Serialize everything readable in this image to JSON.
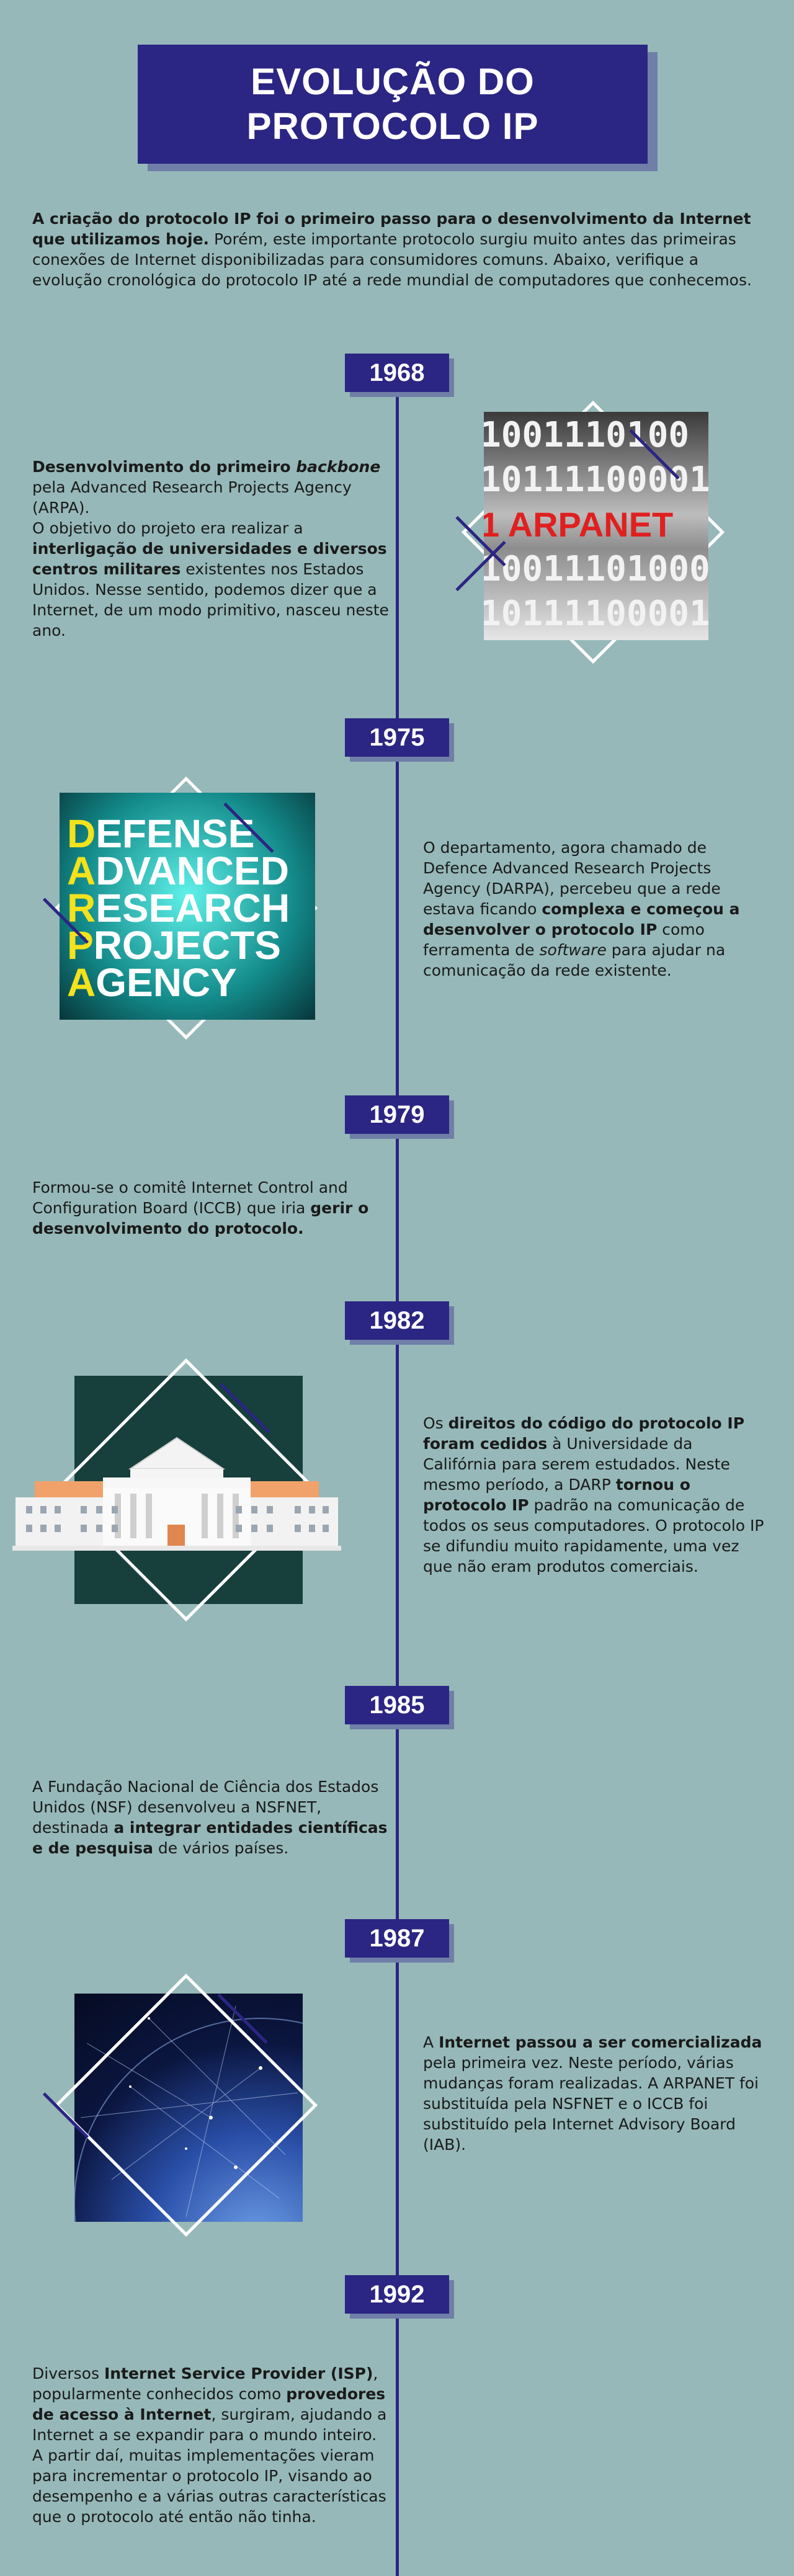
{
  "title": {
    "line1": "EVOLUÇÃO DO",
    "line2": "PROTOCOLO IP"
  },
  "intro": {
    "bold": "A criação do protocolo IP foi o primeiro passo para o desenvolvimento da Internet que utilizamos hoje.",
    "rest": " Porém, este importante protocolo surgiu muito antes das primeiras conexões de Internet disponibilizadas para consumidores comuns. Abaixo, verifique a evolução cronológica do protocolo IP até a rede mundial de computadores que conhecemos."
  },
  "events": [
    {
      "year": "1968",
      "p1_b": "Desenvolvimento do primeiro ",
      "p1_i": "backbone",
      "p1_r": " pela Advanced Research Projects Agency (ARPA).",
      "p2_a": "O objetivo do projeto era realizar a ",
      "p2_b": "interligação de universidades e diversos centros militares",
      "p2_c": " existentes nos Estados Unidos. Nesse sentido, podemos dizer que a Internet, de um modo primitivo, nasceu neste ano.",
      "image_lines": [
        "1001110100",
        "10111100001",
        "1 ARPANET",
        "10011101000",
        "10111100001"
      ],
      "image_alt": "arpanet-image"
    },
    {
      "year": "1975",
      "a": "O departamento, agora chamado de Defence Advanced Research Projects Agency (DARPA), percebeu que a rede estava ficando ",
      "b": "complexa e começou a desenvolver o protocolo IP",
      "c": " como ferramenta de ",
      "i": "software",
      "d": " para ajudar na comunicação da rede existente.",
      "darpa_letters": [
        "D",
        "A",
        "R",
        "P",
        "A"
      ],
      "darpa_words": [
        "EFENSE",
        "DVANCED",
        "ESEARCH",
        "ROJECTS",
        "GENCY"
      ]
    },
    {
      "year": "1979",
      "a": "Formou-se o comitê Internet Control and Configuration Board (ICCB) que iria ",
      "b": "gerir o desenvolvimento do protocolo."
    },
    {
      "year": "1982",
      "a": "Os ",
      "b": "direitos do código do protocolo IP foram cedidos",
      "c": " à Universidade da Califórnia para serem estudados. Neste mesmo período, a DARP ",
      "d": "tornou o protocolo IP",
      "e": " padrão na comunicação de todos os seus computadores. O protocolo IP se difundiu muito rapidamente, uma vez que não eram produtos comerciais."
    },
    {
      "year": "1985",
      "a": "A Fundação Nacional de Ciência dos Estados Unidos (NSF) desenvolveu a NSFNET, destinada ",
      "b": "a integrar entidades científicas e de pesquisa",
      "c": " de vários países."
    },
    {
      "year": "1987",
      "a": "A ",
      "b": "Internet passou a ser comercializada",
      "c": " pela primeira vez. Neste período, várias mudanças foram realizadas. A ARPANET foi substituída pela NSFNET e o ICCB foi substituído pela Internet Advisory Board (IAB)."
    },
    {
      "year": "1992",
      "a": "Diversos ",
      "b": "Internet Service Provider (ISP)",
      "c": ", popularmente conhecidos como ",
      "d": "provedores de acesso à Internet",
      "e": ", surgiram, ajudando a Internet a se expandir para o mundo inteiro.",
      "f": "A partir daí, muitas implementações vieram para incrementar o protocolo IP, visando ao desempenho e a várias outras características que o protocolo até então não tinha."
    }
  ],
  "colors": {
    "background": "#96b8b8",
    "navy": "#2b2583",
    "shadow": "#6f7fa7"
  }
}
